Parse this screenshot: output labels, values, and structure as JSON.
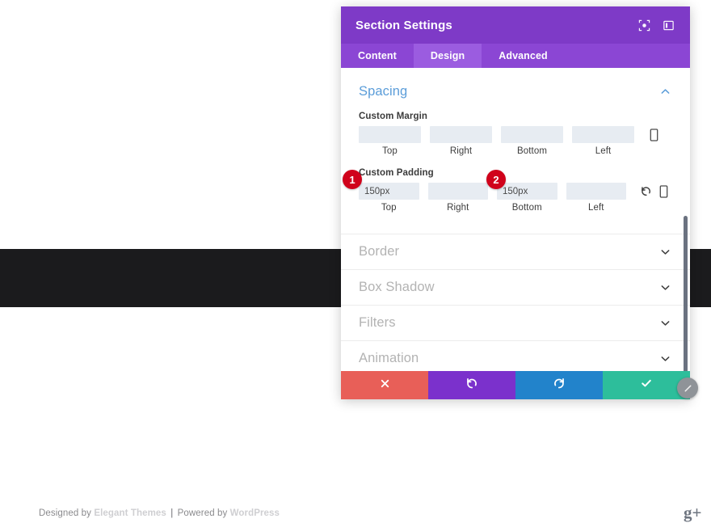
{
  "site": {
    "footer_prefix": "Designed by ",
    "footer_brand1": "Elegant Themes",
    "footer_separator": " | ",
    "footer_middle": "Powered by ",
    "footer_brand2": "WordPress",
    "social_icon_label": "g+"
  },
  "panel": {
    "title": "Section Settings",
    "header_icons": [
      {
        "name": "target-icon",
        "label": "target"
      },
      {
        "name": "layout-toggle-icon",
        "label": "layout"
      }
    ],
    "tabs": [
      {
        "label": "Content",
        "active": false
      },
      {
        "label": "Design",
        "active": true
      },
      {
        "label": "Advanced",
        "active": false
      }
    ],
    "spacing": {
      "title": "Spacing",
      "collapse_icon": "chevron-up-icon",
      "custom_margin": {
        "label": "Custom Margin",
        "fields": [
          {
            "caption": "Top",
            "value": "",
            "placeholder": ""
          },
          {
            "caption": "Right",
            "value": "",
            "placeholder": ""
          },
          {
            "caption": "Bottom",
            "value": "",
            "placeholder": ""
          },
          {
            "caption": "Left",
            "value": "",
            "placeholder": ""
          }
        ],
        "tools": [
          {
            "name": "mobile-device-icon",
            "visible": true
          }
        ]
      },
      "custom_padding": {
        "label": "Custom Padding",
        "fields": [
          {
            "caption": "Top",
            "value": "150px",
            "placeholder": ""
          },
          {
            "caption": "Right",
            "value": "",
            "placeholder": ""
          },
          {
            "caption": "Bottom",
            "value": "150px",
            "placeholder": ""
          },
          {
            "caption": "Left",
            "value": "",
            "placeholder": ""
          }
        ],
        "tools": [
          {
            "name": "reset-icon",
            "visible": true
          },
          {
            "name": "mobile-device-icon",
            "visible": true
          }
        ]
      }
    },
    "sections": [
      {
        "label": "Border",
        "icon": "chevron-down-icon"
      },
      {
        "label": "Box Shadow",
        "icon": "chevron-down-icon"
      },
      {
        "label": "Filters",
        "icon": "chevron-down-icon"
      },
      {
        "label": "Animation",
        "icon": "chevron-down-icon"
      }
    ],
    "actions": [
      {
        "name": "cancel-button",
        "icon": "close-icon",
        "color": "#e85f58"
      },
      {
        "name": "undo-button",
        "icon": "undo-icon",
        "color": "#7b31cc"
      },
      {
        "name": "redo-button",
        "icon": "redo-icon",
        "color": "#2283cb"
      },
      {
        "name": "save-button",
        "icon": "check-icon",
        "color": "#2dbe9b"
      }
    ]
  },
  "annotations": {
    "steps": [
      {
        "number": "1",
        "target": "padding-top-field"
      },
      {
        "number": "2",
        "target": "padding-bottom-field"
      }
    ]
  },
  "colors": {
    "panel_header": "#7e3ac7",
    "tab_bar": "#8b46d4",
    "tab_active": "#9b5ce0",
    "spacing_heading": "#5b9dd9",
    "badge": "#d0021b",
    "input_bg": "#e7ecf2"
  }
}
